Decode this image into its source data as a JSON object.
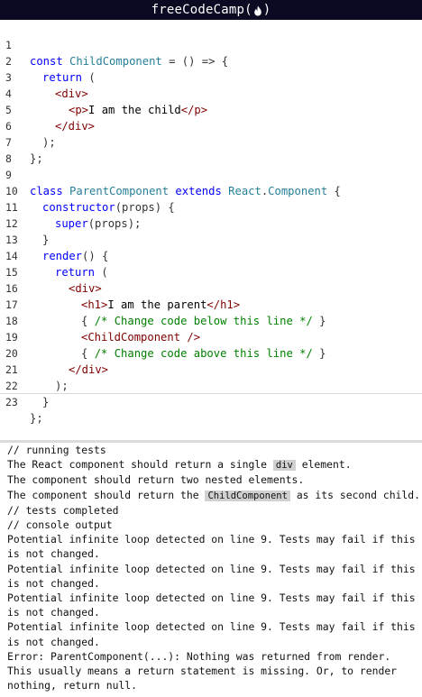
{
  "header": {
    "brand_name": "freeCodeCamp",
    "paren_open": "(",
    "paren_close": ")"
  },
  "editor": {
    "line_numbers": [
      "1",
      "2",
      "3",
      "4",
      "5",
      "6",
      "7",
      "8",
      "9",
      "10",
      "11",
      "12",
      "13",
      "14",
      "15",
      "16",
      "17",
      "18",
      "19",
      "20",
      "21",
      "22",
      "23"
    ],
    "lines": {
      "l1_kw": "const ",
      "l1_name": "ChildComponent",
      "l1_rest": " = () => {",
      "l2_kw": "return",
      "l2_rest": " (",
      "l3": "<div>",
      "l4_open": "<p>",
      "l4_text": "I am the child",
      "l4_close": "</p>",
      "l5": "</div>",
      "l6": ");",
      "l7": "};",
      "l9_kw": "class ",
      "l9_name": "ParentComponent",
      "l9_ext": " extends ",
      "l9_base": "React",
      "l9_dot": ".",
      "l9_comp": "Component",
      "l9_rest": " {",
      "l10_fn": "constructor",
      "l10_rest": "(props) {",
      "l11_fn": "super",
      "l11_rest": "(props);",
      "l12": "}",
      "l13_fn": "render",
      "l13_rest": "() {",
      "l14_kw": "return",
      "l14_rest": " (",
      "l15": "<div>",
      "l16_open": "<h1>",
      "l16_text": "I am the parent",
      "l16_close": "</h1>",
      "l17_open": "{ ",
      "l17_comment": "/* Change code below this line */",
      "l17_close": " }",
      "l18": "<ChildComponent />",
      "l19_open": "{ ",
      "l19_comment": "/* Change code above this line */",
      "l19_close": " }",
      "l20": "</div>",
      "l21": ");",
      "l22": "}",
      "l23": "};"
    }
  },
  "console": {
    "running_tests": "// running tests",
    "test1_pre": "The React component should return a single ",
    "test1_chip": "div",
    "test1_post": " element.",
    "test2": "The component should return two nested elements.",
    "test3_pre": "The component should return the ",
    "test3_chip": "ChildComponent",
    "test3_post": " as its second child.",
    "tests_completed": "// tests completed",
    "console_output": "// console output",
    "warn1_a": "Potential infinite loop detected on line 9. Tests may fail if this",
    "warn1_b": "is not changed.",
    "warn2_a": "Potential infinite loop detected on line 9. Tests may fail if this",
    "warn2_b": "is not changed.",
    "warn3_a": "Potential infinite loop detected on line 9. Tests may fail if this",
    "warn3_b": "is not changed.",
    "warn4_a": "Potential infinite loop detected on line 9. Tests may fail if this",
    "warn4_b": "is not changed.",
    "error_a": "Error: ParentComponent(...): Nothing was returned from render.",
    "error_b": "This usually means a return statement is missing. Or, to render",
    "error_c": "nothing, return null."
  }
}
